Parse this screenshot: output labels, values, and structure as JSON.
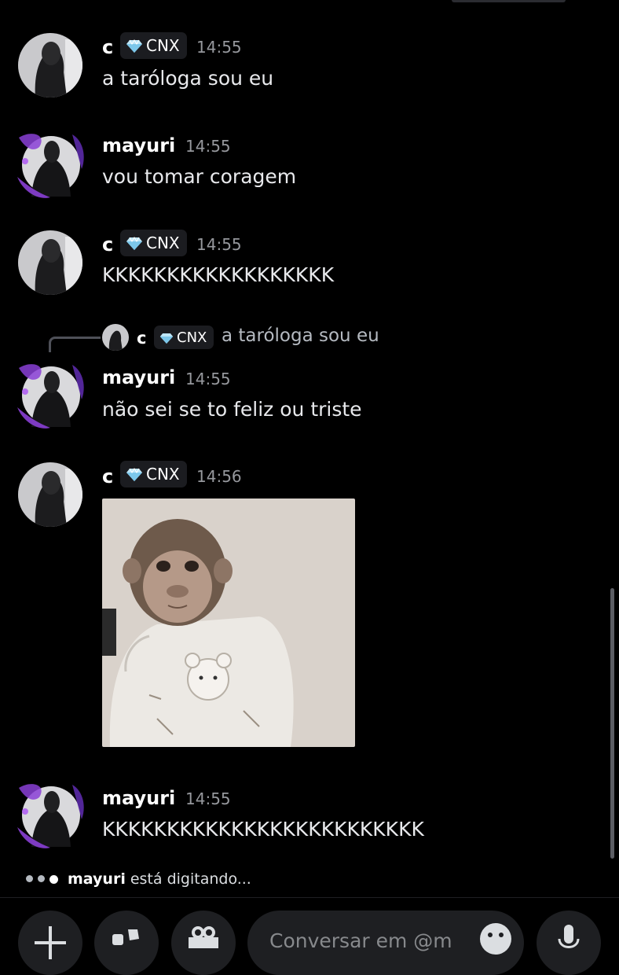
{
  "messages": [
    {
      "author": "c",
      "badge": "CNX",
      "time": "14:55",
      "text": "a taróloga sou eu"
    },
    {
      "author": "mayuri",
      "time": "14:55",
      "text": "vou tomar coragem"
    },
    {
      "author": "c",
      "badge": "CNX",
      "time": "14:55",
      "text": "KKKKKKKKKKKKKKKKKK"
    },
    {
      "author": "mayuri",
      "time": "14:55",
      "text": "não sei se to feliz ou triste",
      "reply": {
        "author": "c",
        "badge": "CNX",
        "text": "a taróloga sou eu"
      }
    },
    {
      "author": "c",
      "badge": "CNX",
      "time": "14:56",
      "attachment": "monkey-in-sweater-image"
    },
    {
      "author": "mayuri",
      "time": "14:55",
      "text": "KKKKKKKKKKKKKKKKKKKKKKKKK"
    }
  ],
  "typing": {
    "user": "mayuri",
    "text": "está digitando..."
  },
  "composer": {
    "placeholder": "Conversar em @m"
  },
  "icons": {
    "badge": "diamond-icon",
    "composer_buttons": [
      "plus-icon",
      "apps-icon",
      "gift-icon"
    ],
    "composer_trailing": [
      "emoji-icon",
      "microphone-icon"
    ]
  },
  "colors": {
    "background": "#000000",
    "surface": "#1e1f22",
    "muted_text": "#96989d",
    "avatar_accent": "#8a3fd6"
  }
}
